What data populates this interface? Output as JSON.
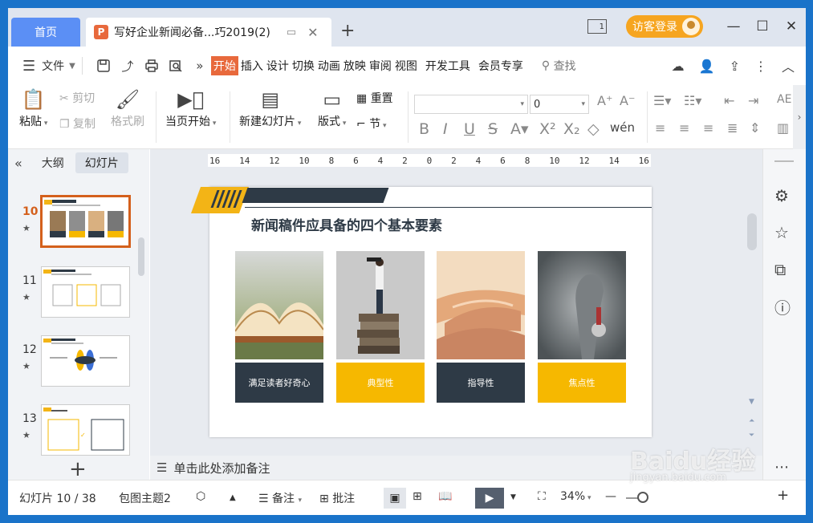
{
  "tabs": {
    "home": "首页",
    "doc_icon": "P",
    "doc_title": "写好企业新闻必备...巧2019(2)"
  },
  "title_right": {
    "window_count": "1",
    "visitor_login": "访客登录"
  },
  "menu": {
    "file": "文件",
    "items": [
      "开始",
      "插入",
      "设计",
      "切换",
      "动画",
      "放映",
      "审阅",
      "视图",
      "开发工具",
      "会员专享"
    ],
    "search": "查找"
  },
  "ribbon": {
    "paste": "粘贴",
    "cut": "剪切",
    "copy": "复制",
    "format_painter": "格式刷",
    "play_from_current": "当页开始",
    "new_slide": "新建幻灯片",
    "layout": "版式",
    "reset": "重置",
    "section": "节",
    "font_name": "",
    "font_size": "0"
  },
  "left_panel": {
    "outline": "大纲",
    "slides": "幻灯片",
    "thumbs": [
      {
        "num": "10",
        "star": "★"
      },
      {
        "num": "11",
        "star": "★"
      },
      {
        "num": "12",
        "star": "★"
      },
      {
        "num": "13",
        "star": "★"
      }
    ]
  },
  "ruler": [
    "16",
    "14",
    "12",
    "10",
    "8",
    "6",
    "4",
    "2",
    "0",
    "2",
    "4",
    "6",
    "8",
    "10",
    "12",
    "14",
    "16"
  ],
  "slide": {
    "title": "新闻稿件应具备的四个基本要素",
    "cards": [
      {
        "label": "满足读者好奇心"
      },
      {
        "label": "典型性"
      },
      {
        "label": "指导性"
      },
      {
        "label": "焦点性"
      }
    ]
  },
  "notes": {
    "placeholder": "单击此处添加备注"
  },
  "status": {
    "slide_counter": "幻灯片 10 / 38",
    "theme": "包图主题2",
    "notes": "备注",
    "comments": "批注",
    "zoom": "34%"
  },
  "watermark": {
    "logo": "Baidu经验",
    "url": "jingyan.baidu.com"
  },
  "colors": {
    "accent": "#e8693c",
    "home_tab": "#5b8ff5",
    "visitor": "#f6a520",
    "card_yellow": "#f6b800",
    "card_dark": "#2e3a46"
  }
}
